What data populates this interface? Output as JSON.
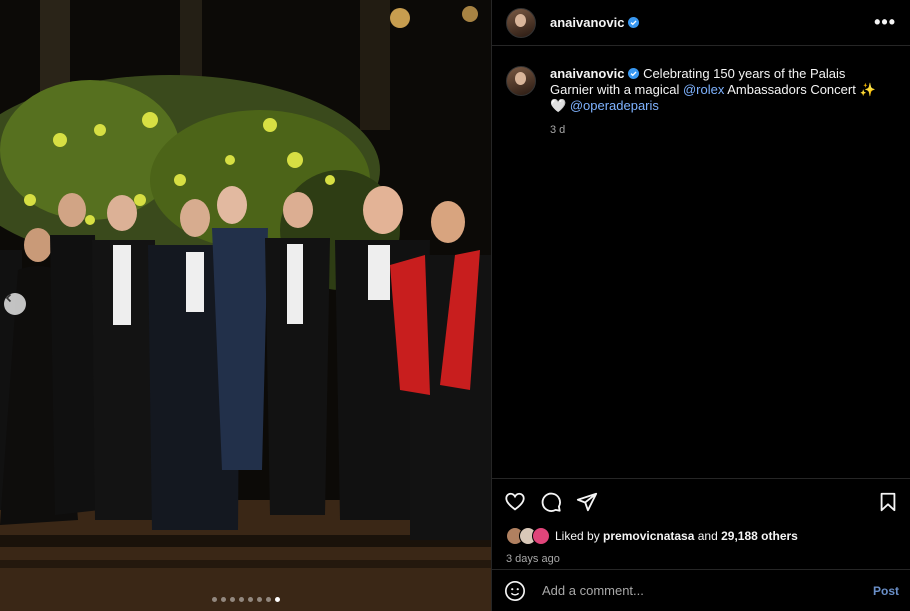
{
  "post": {
    "username": "anaivanovic",
    "caption_prefix": "Celebrating 150 years of the Palais Garnier with a magical ",
    "mention1": "@rolex",
    "caption_middle": " Ambassadors Concert ✨ 🤍 ",
    "mention2": "@operadeparis",
    "relative_time": "3 d",
    "more_icon": "•••"
  },
  "engagement": {
    "liked_by_prefix": "Liked by ",
    "liked_by_user": "premovicnatasa",
    "and": " and ",
    "others_count": "29,188 others",
    "date": "3 days ago"
  },
  "comment": {
    "placeholder": "Add a comment...",
    "post_label": "Post"
  },
  "carousel": {
    "total": 8,
    "active_index": 7
  }
}
